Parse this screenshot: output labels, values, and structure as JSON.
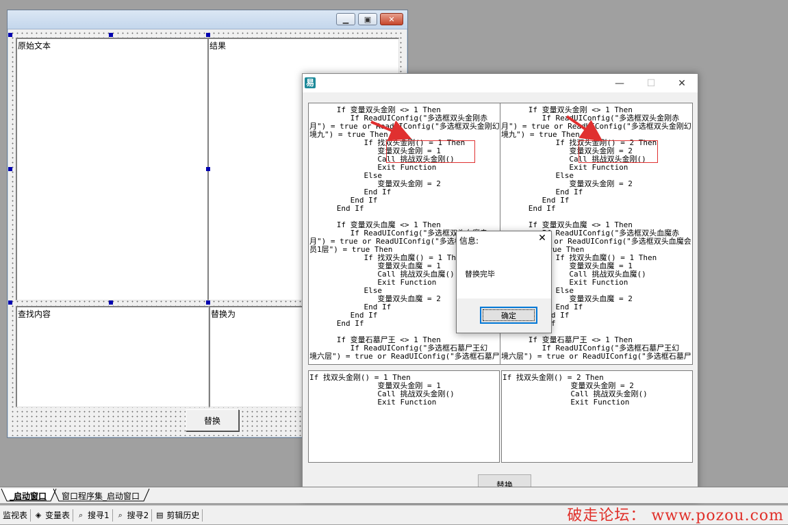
{
  "designer": {
    "labels": {
      "original_text": "原始文本",
      "result": "结果",
      "find_content": "查找内容",
      "replace_with": "替换为"
    },
    "replace_button": "替换"
  },
  "app_window": {
    "icon_glyph": "易",
    "minimize": "—",
    "maximize": "☐",
    "close": "✕",
    "original_code": "      If 变量双头金刚 <> 1 Then\n         If ReadUIConfig(\"多选框双头金刚赤\n月\") = true or ReadUIConfig(\"多选框双头金刚幻\n境九\") = true Then\n            If 找双头金刚() = 1 Then\n               变量双头金刚 = 1\n               Call 挑战双头金刚()\n               Exit Function\n            Else\n               变量双头金刚 = 2\n            End If\n         End If\n      End If\n\n      If 变量双头血魔 <> 1 Then\n         If ReadUIConfig(\"多选框双头血魔赤\n月\") = true or ReadUIConfig(\"多选框双头血魔会\n员1层\") = true Then\n            If 找双头血魔() = 1 Then\n               变量双头血魔 = 1\n               Call 挑战双头血魔()\n               Exit Function\n            Else\n               变量双头血魔 = 2\n            End If\n         End If\n      End If\n\n      If 变量石墓尸王 <> 1 Then\n         If ReadUIConfig(\"多选框石墓尸王幻\n境六层\") = true or ReadUIConfig(\"多选框石墓尸",
    "result_code": "      If 变量双头金刚 <> 1 Then\n         If ReadUIConfig(\"多选框双头金刚赤\n月\") = true or ReadUIConfig(\"多选框双头金刚幻\n境九\") = true Then\n            If 找双头金刚() = 2 Then\n               变量双头金刚 = 2\n               Call 挑战双头金刚()\n               Exit Function\n            Else\n               变量双头金刚 = 2\n            End If\n         End If\n      End If\n\n      If 变量双头血魔 <> 1 Then\n         If ReadUIConfig(\"多选框双头血魔赤\n月\") = true or ReadUIConfig(\"多选框双头血魔会\n员1层\") = true Then\n            If 找双头血魔() = 1 Then\n               变量双头血魔 = 1\n               Call 挑战双头血魔()\n               Exit Function\n            Else\n               变量双头血魔 = 2\n            End If\n         End If\n      End If\n\n      If 变量石墓尸王 <> 1 Then\n         If ReadUIConfig(\"多选框石墓尸王幻\n境六层\") = true or ReadUIConfig(\"多选框石墓尸",
    "find_code": "If 找双头金刚() = 1 Then\n               变量双头金刚 = 1\n               Call 挑战双头金刚()\n               Exit Function",
    "replace_code": "If 找双头金刚() = 2 Then\n               变量双头金刚 = 2\n               Call 挑战双头金刚()\n               Exit Function",
    "replace_button": "替换"
  },
  "message_box": {
    "title": "信息:",
    "close": "✕",
    "message": "替换完毕",
    "ok_button": "确定"
  },
  "tabs": [
    "_启动窗口",
    "窗口程序集_启动窗口"
  ],
  "status_items": [
    {
      "icon": "monitor-icon",
      "label": "监视表"
    },
    {
      "icon": "variables-icon",
      "label": "变量表"
    },
    {
      "icon": "search-icon",
      "label": "搜寻1"
    },
    {
      "icon": "search-icon",
      "label": "搜寻2"
    },
    {
      "icon": "clipboard-icon",
      "label": "剪辑历史"
    }
  ],
  "watermark": "破走论坛： www.pozou.com"
}
